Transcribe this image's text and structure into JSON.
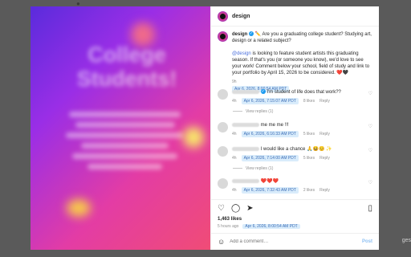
{
  "backdrop": {
    "right_text": "ges"
  },
  "header": {
    "username": "design",
    "verified_mark": "✓"
  },
  "caption": {
    "username": "design",
    "emoji_lead": "✏️",
    "text1": " Are you a graduating college student? Studying art, design or a related subject?",
    "mention": "@design",
    "text2": " is looking to feature student artists this graduating season. If that's you (or someone you know), we'd love to see your work! Comment below your school, field of study and link to your portfolio by April 15, 2026 to be considered. ❤️🖤",
    "age": "9h",
    "date": "Apr 6, 2026, 8:00:54 AM PDT"
  },
  "comments": [
    {
      "text": "I'm student of life does that work??",
      "age": "4h",
      "date": "Apr 6, 2026, 7:15:07 AM PDT",
      "likes": "8 likes",
      "reply": "Reply",
      "replies": "View replies (1)"
    },
    {
      "text": "me me me !!!",
      "age": "4h",
      "date": "Apr 6, 2026, 6:16:33 AM PDT",
      "likes": "5 likes",
      "reply": "Reply",
      "replies": ""
    },
    {
      "text": "I would like a chance 🙏😆😊 ✨",
      "age": "4h",
      "date": "Apr 6, 2026, 7:14:00 AM PDT",
      "likes": "5 likes",
      "reply": "Reply",
      "replies": "View replies (1)"
    },
    {
      "text": "❤️❤️❤️",
      "age": "4h",
      "date": "Apr 6, 2026, 7:32:43 AM PDT",
      "likes": "2 likes",
      "reply": "Reply",
      "replies": ""
    }
  ],
  "footer": {
    "likes": "1,463 likes",
    "ago": "5 hours ago",
    "date": "Apr 6, 2026, 8:00:54 AM PDT",
    "placeholder": "Add a comment…",
    "post": "Post"
  },
  "icons": [
    "heart-icon",
    "comment-icon",
    "share-icon",
    "bookmark-icon",
    "emoji-icon"
  ]
}
